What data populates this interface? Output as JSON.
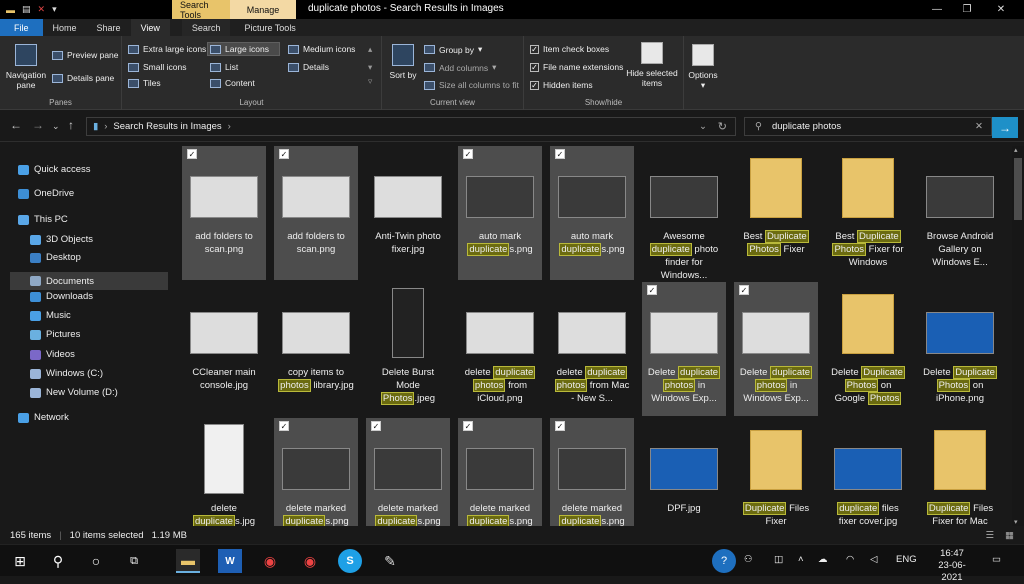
{
  "titlebar": {
    "title": "duplicate photos - Search Results in Images",
    "ctx_search_tools": "Search Tools",
    "ctx_manage": "Manage"
  },
  "tabs": [
    "File",
    "Home",
    "Share",
    "View",
    "Search",
    "Picture Tools"
  ],
  "ribbon": {
    "panes": {
      "label": "Panes",
      "navigation_pane": "Navigation pane",
      "preview_pane": "Preview pane",
      "details_pane": "Details pane"
    },
    "layout": {
      "label": "Layout",
      "extra_large": "Extra large icons",
      "large": "Large icons",
      "medium": "Medium icons",
      "small": "Small icons",
      "list": "List",
      "details": "Details",
      "tiles": "Tiles",
      "content": "Content"
    },
    "current_view": {
      "label": "Current view",
      "sort_by": "Sort by",
      "group_by": "Group by",
      "add_columns": "Add columns",
      "size_all": "Size all columns to fit"
    },
    "show_hide": {
      "label": "Show/hide",
      "item_check_boxes": "Item check boxes",
      "file_name_extensions": "File name extensions",
      "hidden_items": "Hidden items",
      "hide_selected": "Hide selected items"
    },
    "options": "Options"
  },
  "address": {
    "path": "Search Results in Images",
    "search_value": "duplicate photos"
  },
  "nav": [
    {
      "label": "Quick access",
      "color": "#4aa0e6"
    },
    {
      "label": "OneDrive",
      "color": "#3d8fd6"
    },
    {
      "label": "This PC",
      "color": "#5aa7e8"
    },
    {
      "label": "3D Objects",
      "color": "#5aa7e8"
    },
    {
      "label": "Desktop",
      "color": "#3b7fc4"
    },
    {
      "label": "Documents",
      "color": "#8fa8c4"
    },
    {
      "label": "Downloads",
      "color": "#3d8fd6"
    },
    {
      "label": "Music",
      "color": "#4aa0e6"
    },
    {
      "label": "Pictures",
      "color": "#6ab0e0"
    },
    {
      "label": "Videos",
      "color": "#7b68c8"
    },
    {
      "label": "Windows (C:)",
      "color": "#9bb5d8"
    },
    {
      "label": "New Volume (D:)",
      "color": "#9bb5d8"
    },
    {
      "label": "Network",
      "color": "#4aa0e6"
    }
  ],
  "files": [
    {
      "parts": [
        [
          "add folders to scan.png",
          false
        ]
      ],
      "sel": true,
      "thumb": "light"
    },
    {
      "parts": [
        [
          "add folders to scan.png",
          false
        ]
      ],
      "sel": true,
      "thumb": "light"
    },
    {
      "parts": [
        [
          "Anti-Twin photo fixer.jpg",
          false
        ]
      ],
      "sel": false,
      "thumb": "light"
    },
    {
      "parts": [
        [
          "auto mark ",
          false
        ],
        [
          "duplicate",
          true
        ],
        [
          "s.png",
          false
        ]
      ],
      "sel": true,
      "thumb": "dark"
    },
    {
      "parts": [
        [
          "auto mark ",
          false
        ],
        [
          "duplicate",
          true
        ],
        [
          "s.png",
          false
        ]
      ],
      "sel": true,
      "thumb": "dark"
    },
    {
      "parts": [
        [
          "Awesome ",
          false
        ],
        [
          "duplicate",
          true
        ],
        [
          " photo finder for Windows...",
          false
        ]
      ],
      "sel": false,
      "thumb": "dark"
    },
    {
      "parts": [
        [
          "Best ",
          false
        ],
        [
          "Duplicate",
          true
        ],
        [
          " ",
          false
        ],
        [
          "Photos",
          true
        ],
        [
          " Fixer",
          false
        ]
      ],
      "sel": false,
      "thumb": "folder"
    },
    {
      "parts": [
        [
          "Best ",
          false
        ],
        [
          "Duplicate",
          true
        ],
        [
          " ",
          false
        ],
        [
          "Photos",
          true
        ],
        [
          " Fixer for Windows",
          false
        ]
      ],
      "sel": false,
      "thumb": "folder"
    },
    {
      "parts": [
        [
          "Browse Android Gallery on Windows E...",
          false
        ]
      ],
      "sel": false,
      "thumb": "dark"
    },
    {
      "parts": [
        [
          "CCleaner main console.jpg",
          false
        ]
      ],
      "sel": false,
      "thumb": "light"
    },
    {
      "parts": [
        [
          "copy items to ",
          false
        ],
        [
          "photos",
          true
        ],
        [
          " library.jpg",
          false
        ]
      ],
      "sel": false,
      "thumb": "light"
    },
    {
      "parts": [
        [
          "Delete Burst Mode ",
          false
        ],
        [
          "Photos",
          true
        ],
        [
          ".jpeg",
          false
        ]
      ],
      "sel": false,
      "thumb": "phone"
    },
    {
      "parts": [
        [
          "delete ",
          false
        ],
        [
          "duplicate",
          true
        ],
        [
          " ",
          false
        ],
        [
          "photos",
          true
        ],
        [
          " from iCloud.png",
          false
        ]
      ],
      "sel": false,
      "thumb": "light"
    },
    {
      "parts": [
        [
          "delete ",
          false
        ],
        [
          "duplicate",
          true
        ],
        [
          " ",
          false
        ],
        [
          "photos",
          true
        ],
        [
          " from Mac - New S...",
          false
        ]
      ],
      "sel": false,
      "thumb": "light"
    },
    {
      "parts": [
        [
          "Delete ",
          false
        ],
        [
          "duplicate",
          true
        ],
        [
          " ",
          false
        ],
        [
          "photos",
          true
        ],
        [
          " in Windows Exp...",
          false
        ]
      ],
      "sel": true,
      "thumb": "light"
    },
    {
      "parts": [
        [
          "Delete ",
          false
        ],
        [
          "duplicate",
          true
        ],
        [
          " ",
          false
        ],
        [
          "photos",
          true
        ],
        [
          " in Windows Exp...",
          false
        ]
      ],
      "sel": true,
      "thumb": "light"
    },
    {
      "parts": [
        [
          "Delete ",
          false
        ],
        [
          "Duplicate",
          true
        ],
        [
          " ",
          false
        ],
        [
          "Photos",
          true
        ],
        [
          " on Google ",
          false
        ],
        [
          "Photos",
          true
        ]
      ],
      "sel": false,
      "thumb": "folder"
    },
    {
      "parts": [
        [
          "Delete ",
          false
        ],
        [
          "Duplicate",
          true
        ],
        [
          " ",
          false
        ],
        [
          "Photos",
          true
        ],
        [
          " on iPhone.png",
          false
        ]
      ],
      "sel": false,
      "thumb": "blue"
    },
    {
      "parts": [
        [
          "delete ",
          false
        ],
        [
          "duplicate",
          true
        ],
        [
          "s.jpg",
          false
        ]
      ],
      "sel": false,
      "thumb": "phone-light"
    },
    {
      "parts": [
        [
          "delete marked ",
          false
        ],
        [
          "duplicate",
          true
        ],
        [
          "s.png",
          false
        ]
      ],
      "sel": true,
      "thumb": "dark"
    },
    {
      "parts": [
        [
          "delete marked ",
          false
        ],
        [
          "duplicate",
          true
        ],
        [
          "s.png",
          false
        ]
      ],
      "sel": true,
      "thumb": "dark"
    },
    {
      "parts": [
        [
          "delete marked ",
          false
        ],
        [
          "duplicate",
          true
        ],
        [
          "s.png",
          false
        ]
      ],
      "sel": true,
      "thumb": "dark"
    },
    {
      "parts": [
        [
          "delete marked ",
          false
        ],
        [
          "duplicate",
          true
        ],
        [
          "s.png",
          false
        ]
      ],
      "sel": true,
      "thumb": "dark"
    },
    {
      "parts": [
        [
          "DPF.jpg",
          false
        ]
      ],
      "sel": false,
      "thumb": "blue"
    },
    {
      "parts": [
        [
          "Duplicate",
          true
        ],
        [
          " Files Fixer",
          false
        ]
      ],
      "sel": false,
      "thumb": "folder"
    },
    {
      "parts": [
        [
          "duplicate",
          true
        ],
        [
          " files fixer cover.jpg",
          false
        ]
      ],
      "sel": false,
      "thumb": "blue"
    },
    {
      "parts": [
        [
          "Duplicate",
          true
        ],
        [
          " Files Fixer for Mac",
          false
        ]
      ],
      "sel": false,
      "thumb": "folder"
    }
  ],
  "status": {
    "count": "165 items",
    "selected": "10 items selected",
    "size": "1.19 MB"
  },
  "taskbar": {
    "lang": "ENG",
    "time": "16:47",
    "date": "23-06-2021"
  }
}
